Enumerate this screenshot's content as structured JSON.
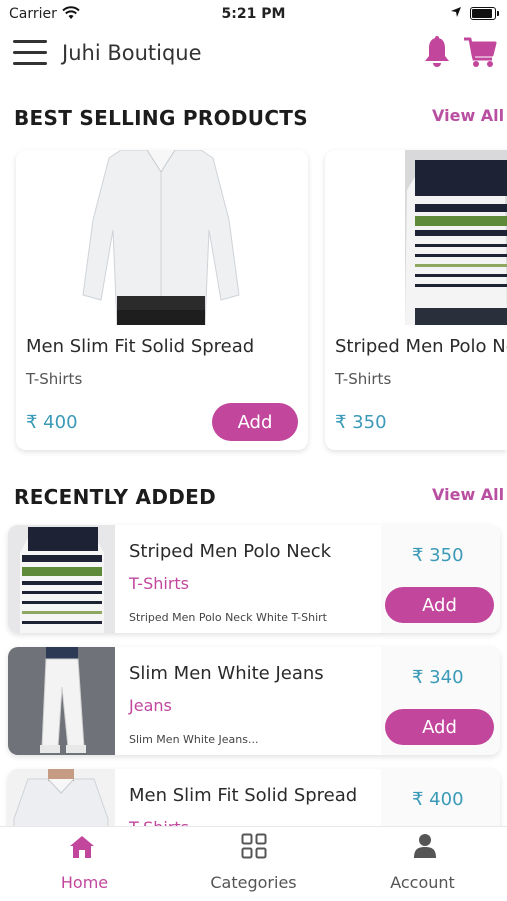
{
  "status_bar": {
    "carrier": "Carrier",
    "time": "5:21 PM"
  },
  "header": {
    "title": "Juhi Boutique"
  },
  "colors": {
    "accent": "#c2479c",
    "price": "#3b9ab8"
  },
  "best_selling": {
    "title": "BEST SELLING PRODUCTS",
    "view_all": "View All",
    "products": [
      {
        "name": "Men Slim Fit Solid Spread",
        "category": "T-Shirts",
        "price": "₹ 400",
        "add_label": "Add"
      },
      {
        "name": "Striped Men Polo Neck",
        "category": "T-Shirts",
        "price": "₹ 350"
      }
    ]
  },
  "recently_added": {
    "title": "RECENTLY ADDED",
    "view_all": "View All",
    "items": [
      {
        "name": "Striped Men Polo Neck",
        "category": "T-Shirts",
        "description": "Striped Men Polo Neck White T-Shirt",
        "price": "₹ 350",
        "add_label": "Add"
      },
      {
        "name": "Slim Men White  Jeans",
        "category": "Jeans",
        "description": "Slim Men White Jeans...",
        "price": "₹ 340",
        "add_label": "Add"
      },
      {
        "name": "Men Slim Fit Solid Spread",
        "category": "T-Shirts",
        "price": "₹ 400"
      }
    ]
  },
  "tabs": [
    {
      "label": "Home",
      "icon": "home-icon",
      "active": true
    },
    {
      "label": "Categories",
      "icon": "grid-icon",
      "active": false
    },
    {
      "label": "Account",
      "icon": "user-icon",
      "active": false
    }
  ]
}
